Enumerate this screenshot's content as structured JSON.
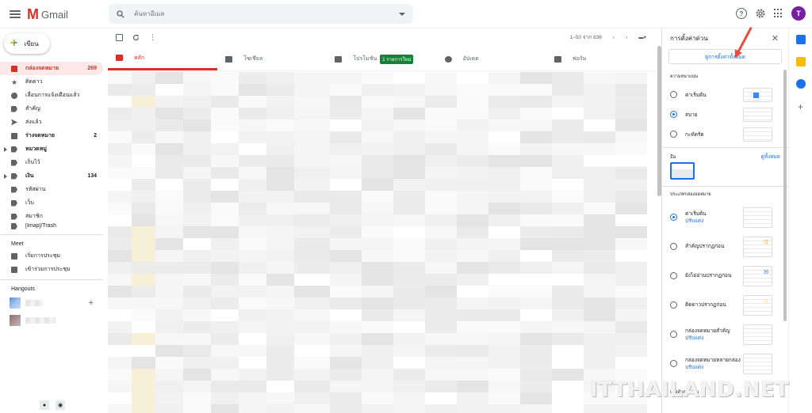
{
  "app": {
    "name": "Gmail",
    "logo_letter": "M"
  },
  "search": {
    "placeholder": "ค้นหาอีเมล"
  },
  "user": {
    "avatar_letter": "T"
  },
  "compose_label": "เขียน",
  "nav": [
    {
      "label": "กล่องจดหมาย",
      "count": "269",
      "icon": "inbox-icon",
      "active": true
    },
    {
      "label": "ติดดาว",
      "count": "",
      "icon": "star-icon"
    },
    {
      "label": "เลื่อนการแจ้งเตือนแล้ว",
      "count": "",
      "icon": "clock-icon"
    },
    {
      "label": "สำคัญ",
      "count": "",
      "icon": "important-icon"
    },
    {
      "label": "ส่งแล้ว",
      "count": "",
      "icon": "send-icon"
    },
    {
      "label": "ร่างจดหมาย",
      "count": "2",
      "icon": "draft-icon",
      "bold": true
    },
    {
      "label": "หมวดหมู่",
      "count": "",
      "icon": "label-icon",
      "bold": true,
      "caret": true
    },
    {
      "label": "เก็บไว้",
      "count": "",
      "icon": "label-icon"
    },
    {
      "label": "เงิน",
      "count": "134",
      "icon": "label-icon",
      "bold": true,
      "caret": true
    },
    {
      "label": "รหัสผ่าน",
      "count": "",
      "icon": "label-icon"
    },
    {
      "label": "เว็บ",
      "count": "",
      "icon": "label-icon"
    },
    {
      "label": "สมาชิก",
      "count": "",
      "icon": "label-icon"
    },
    {
      "label": "[Imap]/Trash",
      "count": "",
      "icon": "label-icon"
    }
  ],
  "meet": {
    "title": "Meet",
    "items": [
      {
        "label": "เริ่มการประชุม",
        "icon": "video-icon"
      },
      {
        "label": "เข้าร่วมการประชุม",
        "icon": "keyboard-icon"
      }
    ]
  },
  "hangouts": {
    "title": "Hangouts",
    "add_symbol": "+"
  },
  "toolbar": {
    "pager": "1–50 จาก 836"
  },
  "tabs": [
    {
      "label": "หลัก",
      "icon": "inbox-icon",
      "active": true
    },
    {
      "label": "โซเชียล",
      "icon": "people-icon"
    },
    {
      "label": "โปรโมชัน",
      "icon": "tag-icon",
      "badge": "1 รายการใหม่"
    },
    {
      "label": "อัปเดต",
      "icon": "info-icon"
    },
    {
      "label": "ฟอรัม",
      "icon": "forum-icon"
    }
  ],
  "settings": {
    "title": "การตั้งค่าด่วน",
    "see_all_button": "ดูการตั้งค่าทั้งหมด",
    "density": {
      "title": "ความหนาแน่น",
      "options": [
        {
          "label": "ค่าเริ่มต้น",
          "selected": false
        },
        {
          "label": "สบาย",
          "selected": true
        },
        {
          "label": "กะทัดรัด",
          "selected": false
        }
      ]
    },
    "theme": {
      "title": "ธีม",
      "link": "ดูทั้งหมด"
    },
    "inbox_type": {
      "title": "ประเภทกล่องจดหมาย",
      "options": [
        {
          "label": "ค่าเริ่มต้น",
          "sublink": "ปรับแต่ง",
          "selected": true
        },
        {
          "label": "สำคัญปรากฏก่อน",
          "sublink": "",
          "selected": false
        },
        {
          "label": "ยังไม่อ่านปรากฏก่อน",
          "sublink": "",
          "selected": false
        },
        {
          "label": "ติดดาวปรากฏก่อน",
          "sublink": "",
          "selected": false
        },
        {
          "label": "กล่องจดหมายสำคัญ",
          "sublink": "ปรับแต่ง",
          "selected": false
        },
        {
          "label": "กล่องจดหมายหลายกล่อง",
          "sublink": "ปรับแต่ง",
          "selected": false
        }
      ]
    },
    "reading_pane_title": "แผงสำหรับอ่าน"
  },
  "watermark": "ITTHAILAND.NET",
  "colors": {
    "accent": "#d93025",
    "link": "#1a73e8",
    "badge": "#188038",
    "avatar": "#7b1fa2"
  }
}
